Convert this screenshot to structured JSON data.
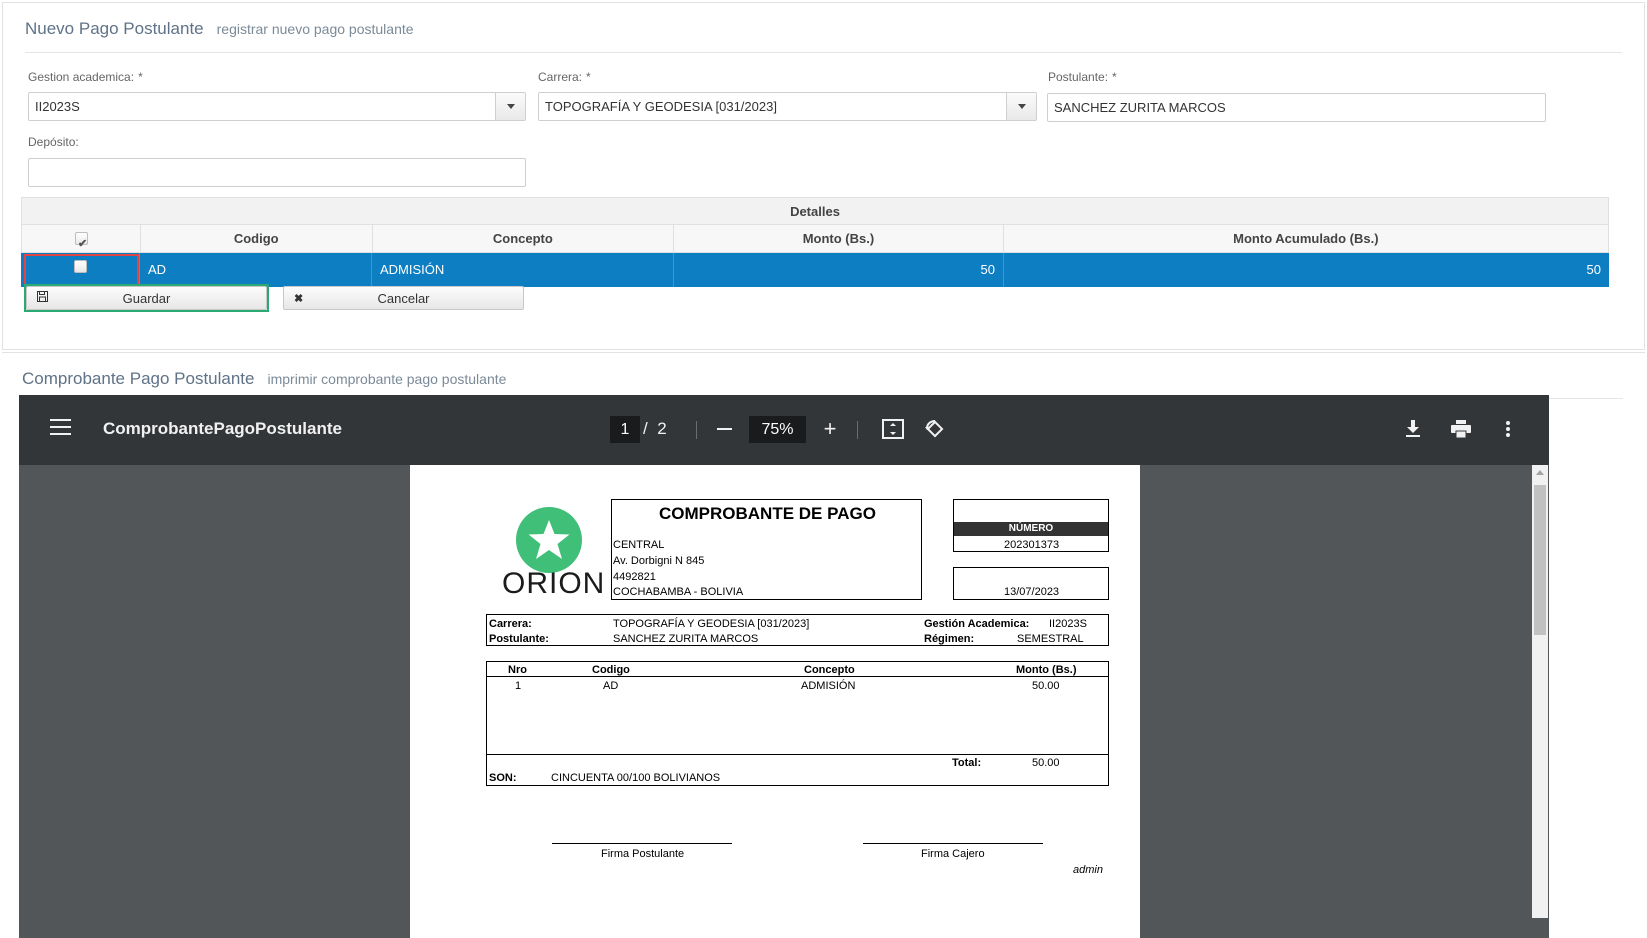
{
  "form": {
    "title": "Nuevo Pago Postulante",
    "subtitle": "registrar nuevo pago postulante",
    "gestion_label": "Gestion academica:",
    "gestion_value": "II2023S",
    "carrera_label": "Carrera:",
    "carrera_value": "TOPOGRAFÍA Y GEODESIA [031/2023]",
    "postulante_label": "Postulante:",
    "postulante_value": "SANCHEZ ZURITA MARCOS",
    "deposito_label": "Depósito:",
    "deposito_value": "",
    "required_mark": "*"
  },
  "detalles": {
    "caption": "Detalles",
    "headers": [
      "Codigo",
      "Concepto",
      "Monto (Bs.)",
      "Monto Acumulado (Bs.)"
    ],
    "rows": [
      {
        "codigo": "AD",
        "concepto": "ADMISIÓN",
        "monto": "50",
        "acumulado": "50"
      }
    ]
  },
  "buttons": {
    "guardar": "Guardar",
    "cancelar": "Cancelar"
  },
  "comprobante": {
    "title": "Comprobante Pago Postulante",
    "subtitle": "imprimir comprobante pago postulante"
  },
  "viewer": {
    "file_name": "ComprobantePagoPostulante",
    "current_page": "1",
    "page_separator": "/",
    "total_pages": "2",
    "zoom": "75%"
  },
  "receipt": {
    "logo_text": "ORION",
    "heading": "COMPROBANTE DE PAGO",
    "address": [
      "CENTRAL",
      "Av. Dorbigni N 845",
      "4492821",
      "COCHABAMBA - BOLIVIA"
    ],
    "numero_label": "NÚMERO",
    "numero": "202301373",
    "fecha": "13/07/2023",
    "carrera_label": "Carrera:",
    "carrera": "TOPOGRAFÍA Y GEODESIA [031/2023]",
    "postulante_label": "Postulante:",
    "postulante": "SANCHEZ ZURITA MARCOS",
    "gestion_label": "Gestión Academica:",
    "gestion": "II2023S",
    "regimen_label": "Régimen:",
    "regimen": "SEMESTRAL",
    "table_headers": [
      "Nro",
      "Codigo",
      "Concepto",
      "Monto (Bs.)"
    ],
    "items": [
      {
        "nro": "1",
        "codigo": "AD",
        "concepto": "ADMISIÓN",
        "monto": "50.00"
      }
    ],
    "total_label": "Total:",
    "total": "50.00",
    "son_label": "SON:",
    "son": "CINCUENTA 00/100 BOLIVIANOS",
    "firma_postulante": "Firma Postulante",
    "firma_cajero": "Firma Cajero",
    "user": "admin"
  },
  "colors": {
    "selected_row": "#0e7ec2",
    "highlight_red": "#e04545",
    "highlight_green": "#2aaa72",
    "logo_green": "#3fbf78",
    "viewer_toolbar": "#323639",
    "viewer_bg": "#525659"
  },
  "icons": [
    "chevron-down-icon",
    "checkbox-icon",
    "save-icon",
    "close-icon",
    "menu-icon",
    "minus-icon",
    "plus-icon",
    "fit-page-icon",
    "rotate-icon",
    "download-icon",
    "print-icon",
    "more-vert-icon",
    "star-icon"
  ]
}
